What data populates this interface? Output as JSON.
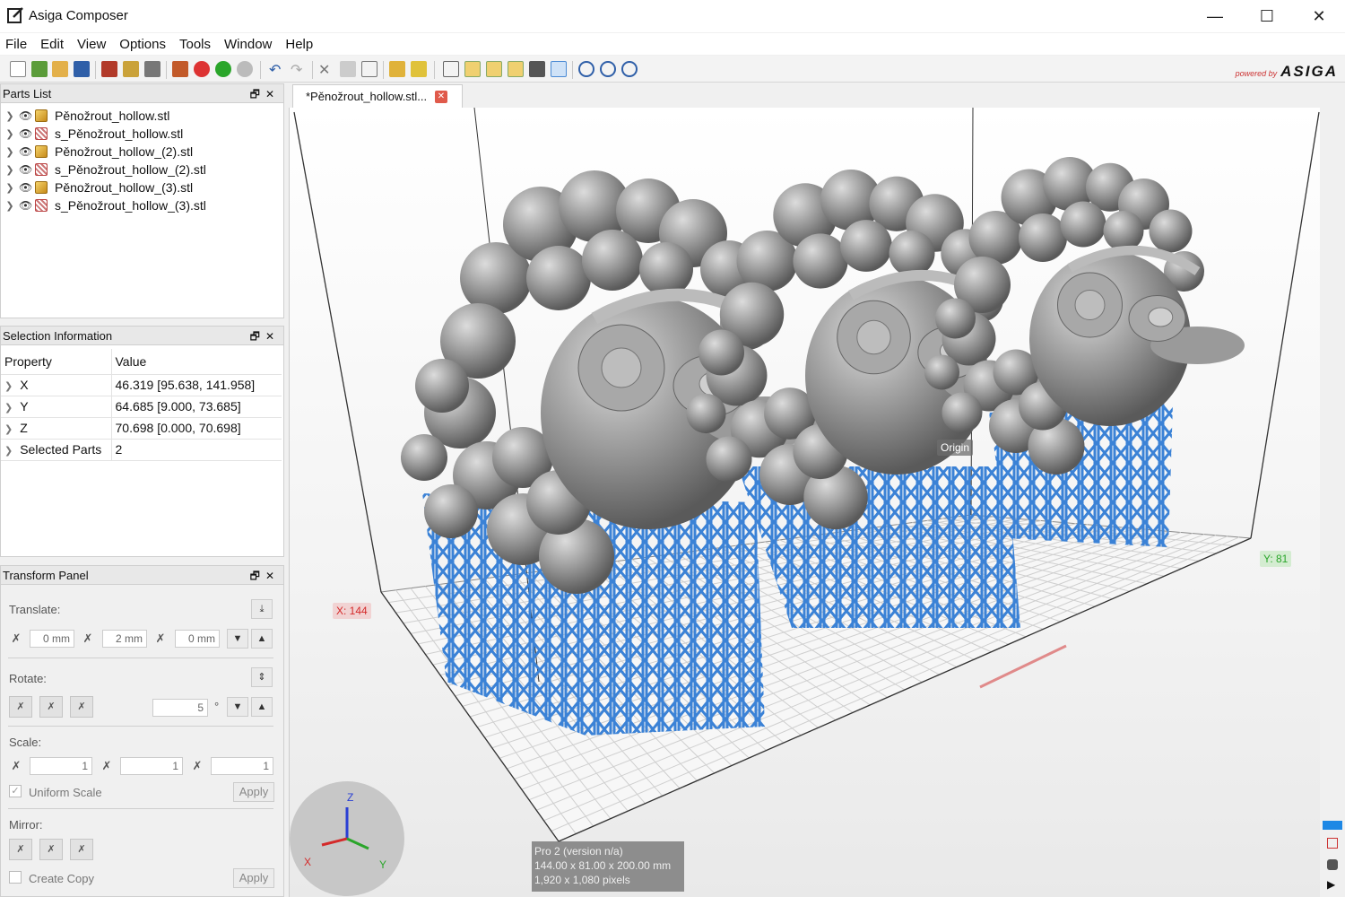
{
  "window": {
    "title": "Asiga Composer",
    "controls": {
      "minimize": "—",
      "maximize": "☐",
      "close": "✕"
    }
  },
  "menu": [
    "File",
    "Edit",
    "View",
    "Options",
    "Tools",
    "Window",
    "Help"
  ],
  "branding": {
    "powered_by": "powered by",
    "name": "ASIGA"
  },
  "parts_list": {
    "title": "Parts List",
    "items": [
      {
        "name": "Pěnožrout_hollow.stl",
        "kind": "solid"
      },
      {
        "name": "s_Pěnožrout_hollow.stl",
        "kind": "support"
      },
      {
        "name": "Pěnožrout_hollow_(2).stl",
        "kind": "solid"
      },
      {
        "name": "s_Pěnožrout_hollow_(2).stl",
        "kind": "support"
      },
      {
        "name": "Pěnožrout_hollow_(3).stl",
        "kind": "solid"
      },
      {
        "name": "s_Pěnožrout_hollow_(3).stl",
        "kind": "support"
      }
    ]
  },
  "selection_info": {
    "title": "Selection Information",
    "headers": {
      "property": "Property",
      "value": "Value"
    },
    "rows": [
      {
        "property": "X",
        "value": "46.319 [95.638, 141.958]"
      },
      {
        "property": "Y",
        "value": "64.685 [9.000, 73.685]"
      },
      {
        "property": "Z",
        "value": "70.698 [0.000, 70.698]"
      },
      {
        "property": "Selected Parts",
        "value": "2"
      }
    ]
  },
  "transform": {
    "title": "Transform Panel",
    "translate": {
      "label": "Translate:",
      "x": "0 mm",
      "y": "2 mm",
      "z": "0 mm"
    },
    "rotate": {
      "label": "Rotate:",
      "value": "5",
      "unit": "°"
    },
    "scale": {
      "label": "Scale:",
      "x": "1",
      "y": "1",
      "z": "1",
      "uniform_label": "Uniform Scale",
      "apply": "Apply"
    },
    "mirror": {
      "label": "Mirror:",
      "copy_label": "Create Copy",
      "apply": "Apply"
    }
  },
  "document": {
    "tab_title": "*Pěnožrout_hollow.stl..."
  },
  "viewport": {
    "origin_label": "Origin",
    "x_axis": "X: 144",
    "y_axis": "Y: 81",
    "gizmo": {
      "x": "X",
      "y": "Y",
      "z": "Z"
    },
    "printer_info": [
      "Pro 2 (version n/a)",
      "144.00 x 81.00 x 200.00 mm",
      "1,920 x 1,080 pixels"
    ],
    "colors": {
      "model": "#8a8a8a",
      "supports": "#3b82d6"
    }
  }
}
